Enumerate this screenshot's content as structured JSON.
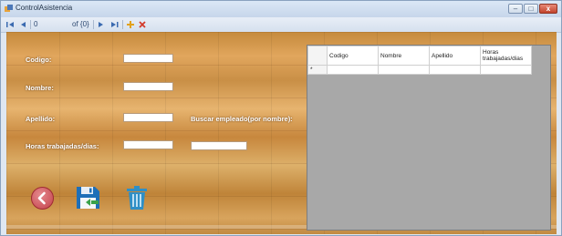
{
  "window": {
    "title": "ControlAsistencia",
    "controls": {
      "minimize": "–",
      "maximize": "□",
      "close": "x"
    }
  },
  "navigator": {
    "position": "0",
    "count_label": "of {0}"
  },
  "form": {
    "codigo_label": "Codigo:",
    "nombre_label": "Nombre:",
    "apellido_label": "Apellido:",
    "horas_label": "Horas trabajadas/dias:",
    "buscar_label": "Buscar empleado(por nombre):",
    "codigo_value": "",
    "nombre_value": "",
    "apellido_value": "",
    "horas_value": "",
    "buscar_value": ""
  },
  "grid": {
    "columns": [
      "Codigo",
      "Nombre",
      "Apellido",
      "Horas trabajadas/dias"
    ],
    "new_row_marker": "*"
  },
  "icons": {
    "back": "back-arrow-icon",
    "save": "floppy-save-icon",
    "delete": "trash-icon"
  },
  "colors": {
    "titlebar": "#c6d6ea",
    "floor": "#d49a51",
    "grid_background": "#a8a8a8",
    "back_button": "#c3414a",
    "save_blue": "#1e6fb8",
    "save_green": "#3aa24a",
    "delete_blue": "#2f8fc6"
  }
}
